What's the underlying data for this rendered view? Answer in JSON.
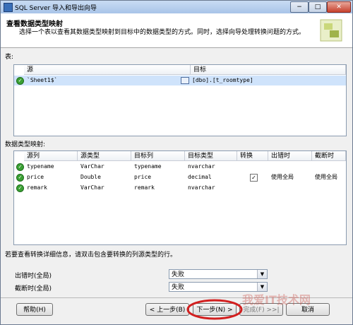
{
  "window": {
    "title": "SQL Server 导入和导出向导",
    "min": "−",
    "max": "□",
    "close": "✕"
  },
  "header": {
    "heading": "查看数据类型映射",
    "description": "选择一个表以查看其数据类型映射到目标中的数据类型的方式。同时，选择向导处理转换问题的方式。"
  },
  "tables": {
    "label": "表:",
    "columns": [
      "源",
      "目标"
    ],
    "rows": [
      {
        "source": "`Sheet1$`",
        "target": "[dbo].[t_roomtype]"
      }
    ]
  },
  "mapping": {
    "label": "数据类型映射:",
    "columns": [
      "源列",
      "源类型",
      "目标列",
      "目标类型",
      "转换",
      "出错时",
      "截断时"
    ],
    "rows": [
      {
        "src_col": "typename",
        "src_type": "VarChar",
        "dst_col": "typename",
        "dst_type": "nvarchar",
        "convert": "",
        "on_error": "",
        "on_trunc": ""
      },
      {
        "src_col": "price",
        "src_type": "Double",
        "dst_col": "price",
        "dst_type": "decimal",
        "convert": "✓",
        "on_error": "使用全局",
        "on_trunc": "使用全局"
      },
      {
        "src_col": "remark",
        "src_type": "VarChar",
        "dst_col": "remark",
        "dst_type": "nvarchar",
        "convert": "",
        "on_error": "",
        "on_trunc": ""
      }
    ]
  },
  "hint": "若要查看转换详细信息，请双击包含要转换的列源类型的行。",
  "global": {
    "on_error_label": "出错时(全局)",
    "on_error_value": "失败",
    "on_trunc_label": "截断时(全局)",
    "on_trunc_value": "失败"
  },
  "buttons": {
    "help": "帮助(H)",
    "back": "< 上一步(B)",
    "next": "下一步(N) >",
    "finish": "完成(F) >>|",
    "cancel": "取消"
  },
  "watermark": "我爱IT技术网",
  "icons": {
    "app": "sql-server-icon",
    "ok": "success-icon",
    "table": "table-icon",
    "logo": "wizard-logo-icon"
  },
  "colors": {
    "highlight_ellipse": "#d21f1f",
    "ok_green": "#3aa033"
  }
}
